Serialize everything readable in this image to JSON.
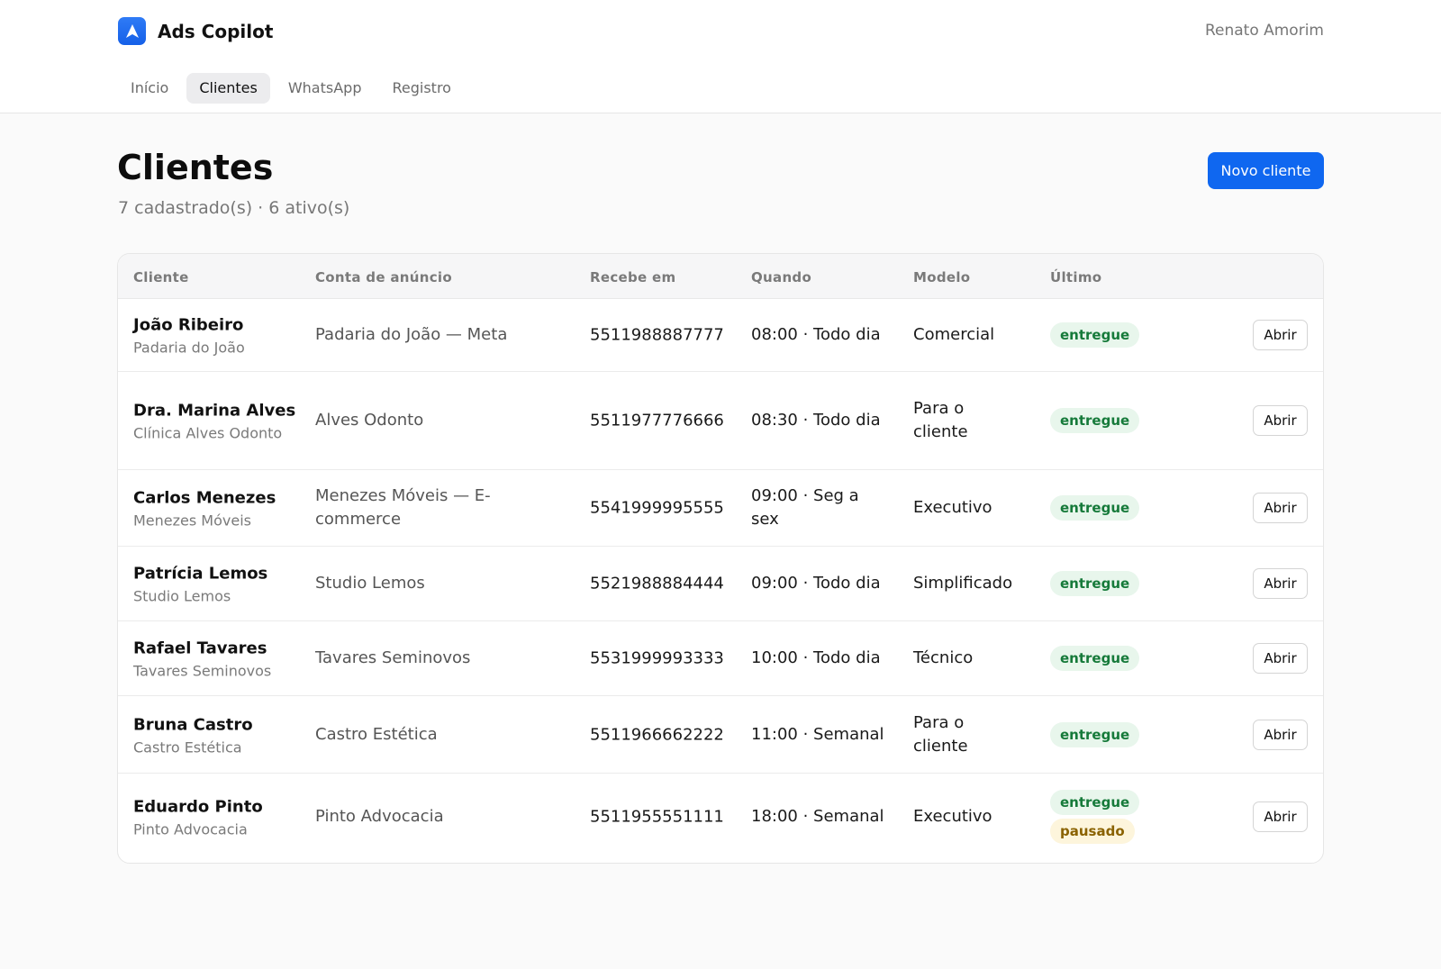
{
  "app": {
    "name": "Ads Copilot",
    "user": "Renato Amorim"
  },
  "nav": {
    "tabs": [
      "Início",
      "Clientes",
      "WhatsApp",
      "Registro"
    ]
  },
  "page": {
    "title": "Clientes",
    "subtitle": "7 cadastrado(s) · 6 ativo(s)",
    "new_button": "Novo cliente"
  },
  "table": {
    "headers": [
      "Cliente",
      "Conta de anúncio",
      "Recebe em",
      "Quando",
      "Modelo",
      "Último"
    ],
    "open_label": "Abrir",
    "rows": [
      {
        "name": "João Ribeiro",
        "business": "Padaria do João",
        "account": "Padaria do João — Meta",
        "phone": "5511988887777",
        "when": "08:00 · Todo dia",
        "model": "Comercial",
        "status": [
          "entregue"
        ]
      },
      {
        "name": "Dra. Marina Alves",
        "business": "Clínica Alves Odonto",
        "account": "Alves Odonto",
        "phone": "5511977776666",
        "when": "08:30 · Todo dia",
        "model": "Para o cliente",
        "status": [
          "entregue"
        ]
      },
      {
        "name": "Carlos Menezes",
        "business": "Menezes Móveis",
        "account": "Menezes Móveis — E-commerce",
        "phone": "5541999995555",
        "when": "09:00 · Seg a sex",
        "model": "Executivo",
        "status": [
          "entregue"
        ]
      },
      {
        "name": "Patrícia Lemos",
        "business": "Studio Lemos",
        "account": "Studio Lemos",
        "phone": "5521988884444",
        "when": "09:00 · Todo dia",
        "model": "Simplificado",
        "status": [
          "entregue"
        ]
      },
      {
        "name": "Rafael Tavares",
        "business": "Tavares Seminovos",
        "account": "Tavares Seminovos",
        "phone": "5531999993333",
        "when": "10:00 · Todo dia",
        "model": "Técnico",
        "status": [
          "entregue"
        ]
      },
      {
        "name": "Bruna Castro",
        "business": "Castro Estética",
        "account": "Castro Estética",
        "phone": "5511966662222",
        "when": "11:00 · Semanal",
        "model": "Para o cliente",
        "status": [
          "entregue"
        ]
      },
      {
        "name": "Eduardo Pinto",
        "business": "Pinto Advocacia",
        "account": "Pinto Advocacia",
        "phone": "5511955551111",
        "when": "18:00 · Semanal",
        "model": "Executivo",
        "status": [
          "entregue",
          "pausado"
        ]
      }
    ]
  },
  "colors": {
    "accent": "#0f67f0",
    "ok": "#167a3a",
    "paused": "#8a6200"
  },
  "icons": {
    "logo": "navigation-arrow-icon"
  }
}
